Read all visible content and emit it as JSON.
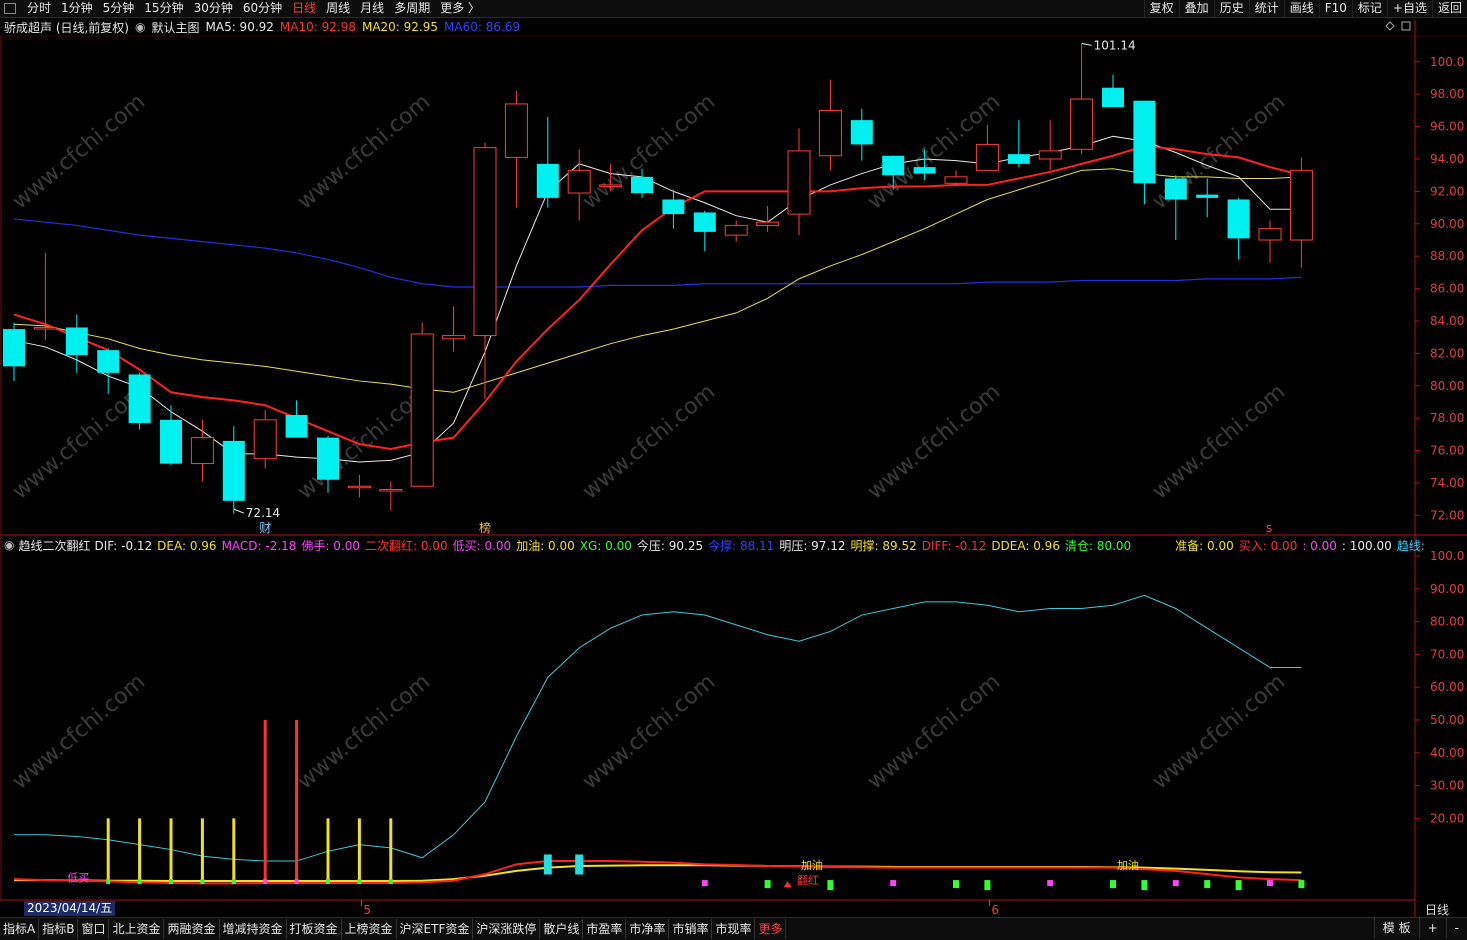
{
  "topbar": {
    "tabs": [
      "分时",
      "1分钟",
      "5分钟",
      "15分钟",
      "30分钟",
      "60分钟",
      "日线",
      "周线",
      "月线",
      "多周期",
      "更多 〉"
    ],
    "active_tab": "日线",
    "right_buttons": [
      "复权",
      "叠加",
      "历史",
      "统计",
      "画线",
      "F10",
      "标记",
      "+自选",
      "返回"
    ]
  },
  "main_header": {
    "stock": "骄成超声 (日线,前复权)",
    "template": "默认主图",
    "ma": [
      {
        "label": "MA5: 90.92",
        "color": "#e8e8e8"
      },
      {
        "label": "MA10: 92.98",
        "color": "#ff3030"
      },
      {
        "label": "MA20: 92.95",
        "color": "#f0e020"
      },
      {
        "label": "MA60: 86.69",
        "color": "#3040ff"
      }
    ]
  },
  "main_axis": {
    "labels": [
      "100.0",
      "98.00",
      "96.00",
      "94.00",
      "92.00",
      "90.00",
      "88.00",
      "86.00",
      "84.00",
      "82.00",
      "80.00",
      "78.00",
      "76.00",
      "74.00",
      "72.00"
    ]
  },
  "annotations": {
    "high": "101.14",
    "low": "72.14",
    "tag_cai": "财",
    "tag_bang": "榜",
    "tag_s": "s"
  },
  "sub_header": {
    "name": "趋线二次翻红",
    "items": [
      {
        "label": "DIF: -0.12",
        "color": "#e8e8e8"
      },
      {
        "label": "DEA: 0.96",
        "color": "#f0e020"
      },
      {
        "label": "MACD: -2.18",
        "color": "#ff40ff"
      },
      {
        "label": "佛手: 0.00",
        "color": "#ff40ff"
      },
      {
        "label": "二次翻红: 0.00",
        "color": "#ff3030"
      },
      {
        "label": "低买: 0.00",
        "color": "#ff40ff"
      },
      {
        "label": "加油: 0.00",
        "color": "#f0e020"
      },
      {
        "label": "XG: 0.00",
        "color": "#30ff30"
      },
      {
        "label": "今压: 90.25",
        "color": "#e8e8e8"
      },
      {
        "label": "今撑: 88.11",
        "color": "#3040ff"
      },
      {
        "label": "明压: 97.12",
        "color": "#e8e8e8"
      },
      {
        "label": "明撑: 89.52",
        "color": "#f0e020"
      },
      {
        "label": "DIFF: -0.12",
        "color": "#ff3030"
      },
      {
        "label": "DDEA: 0.96",
        "color": "#f0e020"
      },
      {
        "label": "清仓: 80.00",
        "color": "#30ff30"
      },
      {
        "label": "准备: 0.00",
        "color": "#f0e020"
      },
      {
        "label": "买入: 0.00",
        "color": "#ff3030"
      },
      {
        "label": ": 0.00",
        "color": "#ff40ff"
      },
      {
        "label": ": 100.00",
        "color": "#e8e8e8"
      },
      {
        "label": "趋线:",
        "color": "#30d0ff"
      }
    ]
  },
  "sub_axis": {
    "labels": [
      "100.0",
      "90.00",
      "80.00",
      "70.00",
      "60.00",
      "50.00",
      "40.00",
      "30.00",
      "20.00"
    ]
  },
  "sub_annotations": {
    "jiayou1": "加油",
    "fanhong": "翻红",
    "jiayou2": "加油",
    "dimai": "低买"
  },
  "x_axis": {
    "date_box": "2023/04/14/五",
    "month5": "5",
    "month6": "6",
    "period": "日线"
  },
  "watermark": "www.cfchi.com",
  "bottombar": {
    "tabs": [
      "指标A",
      "指标B",
      "窗口",
      "北上资金",
      "两融资金",
      "增减持资金",
      "打板资金",
      "上榜资金",
      "沪深ETF资金",
      "沪深涨跌停",
      "散户线",
      "市盈率",
      "市净率",
      "市销率",
      "市现率",
      "更多"
    ],
    "active_tab": "更多",
    "right": [
      "模 板",
      "+",
      "-"
    ]
  },
  "chart_data": {
    "type": "candlestick",
    "candles": [
      {
        "o": 83.5,
        "c": 81.2,
        "h": 83.9,
        "l": 80.3
      },
      {
        "o": 83.6,
        "c": 83.6,
        "h": 88.2,
        "l": 82.8
      },
      {
        "o": 83.6,
        "c": 81.9,
        "h": 84.4,
        "l": 80.8
      },
      {
        "o": 82.2,
        "c": 80.8,
        "h": 82.3,
        "l": 79.5
      },
      {
        "o": 80.7,
        "c": 77.7,
        "h": 80.8,
        "l": 77.3
      },
      {
        "o": 77.9,
        "c": 75.2,
        "h": 78.8,
        "l": 75.1
      },
      {
        "o": 75.2,
        "c": 76.8,
        "h": 77.9,
        "l": 74.1
      },
      {
        "o": 76.6,
        "c": 72.9,
        "h": 77.5,
        "l": 72.1
      },
      {
        "o": 75.5,
        "c": 77.9,
        "h": 78.5,
        "l": 74.9
      },
      {
        "o": 78.2,
        "c": 76.8,
        "h": 79.1,
        "l": 76.8
      },
      {
        "o": 76.8,
        "c": 74.2,
        "h": 76.9,
        "l": 73.4
      },
      {
        "o": 73.8,
        "c": 73.8,
        "h": 74.5,
        "l": 73.1
      },
      {
        "o": 73.6,
        "c": 73.6,
        "h": 74.1,
        "l": 72.3
      },
      {
        "o": 73.8,
        "c": 83.2,
        "h": 83.9,
        "l": 73.8
      },
      {
        "o": 82.9,
        "c": 83.1,
        "h": 84.9,
        "l": 82.1
      },
      {
        "o": 83.1,
        "c": 94.7,
        "h": 95.0,
        "l": 79.2
      },
      {
        "o": 94.1,
        "c": 97.4,
        "h": 98.2,
        "l": 91.0
      },
      {
        "o": 93.7,
        "c": 91.6,
        "h": 96.6,
        "l": 91.0
      },
      {
        "o": 91.9,
        "c": 93.3,
        "h": 94.6,
        "l": 90.2
      },
      {
        "o": 92.4,
        "c": 92.4,
        "h": 93.7,
        "l": 92.0
      },
      {
        "o": 92.9,
        "c": 91.9,
        "h": 93.4,
        "l": 91.6
      },
      {
        "o": 91.5,
        "c": 90.6,
        "h": 92.1,
        "l": 89.7
      },
      {
        "o": 90.7,
        "c": 89.5,
        "h": 90.8,
        "l": 88.3
      },
      {
        "o": 89.3,
        "c": 89.9,
        "h": 90.2,
        "l": 88.9
      },
      {
        "o": 89.9,
        "c": 90.1,
        "h": 91.1,
        "l": 89.5
      },
      {
        "o": 90.6,
        "c": 94.5,
        "h": 95.9,
        "l": 89.3
      },
      {
        "o": 94.2,
        "c": 97.0,
        "h": 98.9,
        "l": 93.3
      },
      {
        "o": 96.4,
        "c": 94.9,
        "h": 97.1,
        "l": 93.9
      },
      {
        "o": 94.2,
        "c": 93.0,
        "h": 94.2,
        "l": 92.1
      },
      {
        "o": 93.5,
        "c": 93.1,
        "h": 94.6,
        "l": 92.7
      },
      {
        "o": 92.5,
        "c": 92.9,
        "h": 93.3,
        "l": 92.3
      },
      {
        "o": 93.3,
        "c": 94.9,
        "h": 96.1,
        "l": 93.3
      },
      {
        "o": 94.3,
        "c": 93.7,
        "h": 96.4,
        "l": 93.5
      },
      {
        "o": 94.0,
        "c": 94.5,
        "h": 96.4,
        "l": 93.3
      },
      {
        "o": 94.6,
        "c": 97.7,
        "h": 101.1,
        "l": 94.3
      },
      {
        "o": 98.4,
        "c": 97.2,
        "h": 99.2,
        "l": 97.2
      },
      {
        "o": 97.6,
        "c": 92.5,
        "h": 97.6,
        "l": 91.2
      },
      {
        "o": 92.8,
        "c": 91.5,
        "h": 93.0,
        "l": 89.0
      },
      {
        "o": 91.8,
        "c": 91.6,
        "h": 92.8,
        "l": 90.4
      },
      {
        "o": 91.5,
        "c": 89.1,
        "h": 91.6,
        "l": 87.8
      },
      {
        "o": 89.0,
        "c": 89.7,
        "h": 90.2,
        "l": 87.6
      },
      {
        "o": 89.0,
        "c": 93.3,
        "h": 94.1,
        "l": 87.3
      }
    ],
    "ma5": [
      82.8,
      82.4,
      81.6,
      80.6,
      79.9,
      78.4,
      77.2,
      75.8,
      75.8,
      75.6,
      75.5,
      75.3,
      75.4,
      75.9,
      77.7,
      82.1,
      87.4,
      92.0,
      93.7,
      93.1,
      92.9,
      92.0,
      91.3,
      90.5,
      90.1,
      91.5,
      92.4,
      93.1,
      93.7,
      94.0,
      93.9,
      93.7,
      94.1,
      94.4,
      94.8,
      95.4,
      95.1,
      94.4,
      93.6,
      92.9,
      90.9,
      90.9
    ],
    "ma10": [
      84.4,
      83.8,
      83.0,
      82.2,
      81.0,
      79.6,
      79.3,
      79.1,
      78.8,
      78.0,
      77.2,
      76.4,
      76.1,
      76.5,
      76.8,
      79.0,
      81.5,
      83.5,
      85.3,
      87.5,
      89.6,
      91.0,
      92.0,
      92.0,
      92.0,
      92.0,
      92.0,
      92.2,
      92.3,
      92.3,
      92.4,
      92.4,
      92.8,
      93.2,
      93.7,
      94.2,
      94.8,
      94.6,
      94.3,
      94.1,
      93.5,
      93.0
    ],
    "ma20": [
      83.8,
      83.7,
      83.3,
      82.9,
      82.3,
      81.9,
      81.6,
      81.4,
      81.2,
      80.9,
      80.6,
      80.3,
      80.1,
      79.8,
      79.6,
      80.2,
      80.8,
      81.4,
      82.0,
      82.6,
      83.1,
      83.5,
      84.0,
      84.5,
      85.4,
      86.6,
      87.4,
      88.1,
      88.9,
      89.7,
      90.6,
      91.5,
      92.1,
      92.7,
      93.3,
      93.4,
      93.1,
      92.9,
      92.9,
      92.8,
      92.8,
      92.9
    ],
    "ma60": [
      90.3,
      90.1,
      89.9,
      89.6,
      89.3,
      89.1,
      88.9,
      88.7,
      88.5,
      88.2,
      87.8,
      87.3,
      86.7,
      86.3,
      86.1,
      86.1,
      86.1,
      86.1,
      86.1,
      86.2,
      86.2,
      86.2,
      86.3,
      86.3,
      86.3,
      86.3,
      86.3,
      86.3,
      86.3,
      86.3,
      86.3,
      86.4,
      86.4,
      86.4,
      86.5,
      86.5,
      86.5,
      86.5,
      86.6,
      86.6,
      86.6,
      86.7
    ],
    "sub_cyan": [
      15,
      15,
      14.5,
      13.5,
      12,
      10.5,
      8.5,
      7.5,
      7,
      7,
      10,
      12,
      11,
      8,
      15,
      25,
      45,
      63,
      72,
      78,
      82,
      83,
      82,
      79,
      76,
      74,
      77,
      82,
      84,
      86,
      86,
      85,
      83,
      84,
      84,
      85,
      88,
      84,
      78,
      72,
      66,
      66
    ],
    "sub_spikes": [
      {
        "i": 3,
        "v": 20,
        "c": "#f0e020"
      },
      {
        "i": 4,
        "v": 20,
        "c": "#f0e020"
      },
      {
        "i": 5,
        "v": 20,
        "c": "#f0e020"
      },
      {
        "i": 6,
        "v": 20,
        "c": "#f0e020"
      },
      {
        "i": 7,
        "v": 20,
        "c": "#f0e020"
      },
      {
        "i": 8,
        "v": 50,
        "c": "#ff3030"
      },
      {
        "i": 9,
        "v": 50,
        "c": "#ff3030"
      },
      {
        "i": 10,
        "v": 20,
        "c": "#f0e020"
      },
      {
        "i": 11,
        "v": 20,
        "c": "#f0e020"
      },
      {
        "i": 12,
        "v": 20,
        "c": "#f0e020"
      }
    ]
  }
}
